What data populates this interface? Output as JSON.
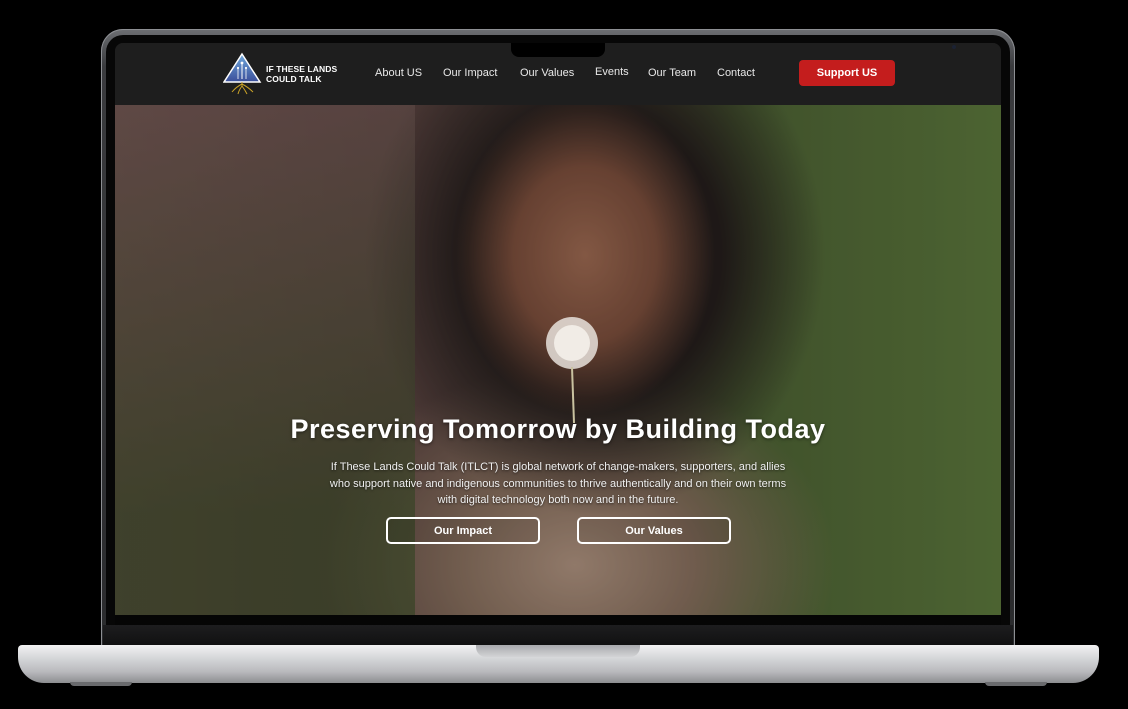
{
  "header": {
    "logo_text_line1": "IF THESE LANDS",
    "logo_text_line2": "COULD TALK",
    "nav": [
      "About US",
      "Our Impact",
      "Our Values",
      "Events",
      "Our Team",
      "Contact"
    ],
    "cta_label": "Support US"
  },
  "hero": {
    "title": "Preserving Tomorrow by Building Today",
    "description": "If These Lands Could Talk (ITLCT) is global network of change-makers, supporters, and allies who support native and indigenous communities to thrive authentically and on their own terms with digital technology both now and in the future.",
    "buttons": [
      "Our Impact",
      "Our Values"
    ]
  },
  "colors": {
    "accent": "#c41d1d",
    "header_bg": "#1e1e1e",
    "text": "#ffffff"
  },
  "icons": {
    "logo": "triangle-tree-logo-icon",
    "hero_image": "child-blowing-dandelion-photo"
  }
}
